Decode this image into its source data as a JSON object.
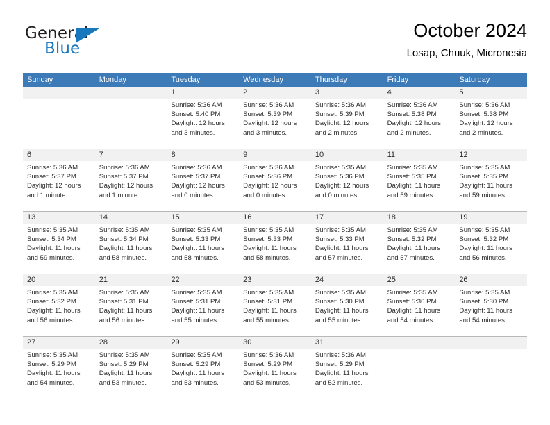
{
  "logo": {
    "word_one": "General",
    "word_two": "Blue",
    "triangle_color": "#1878be",
    "text_color": "#231f20"
  },
  "header": {
    "title": "October 2024",
    "subtitle": "Losap, Chuuk, Micronesia"
  },
  "colors": {
    "header_band": "#3d7ab8",
    "day_band": "#f1f1f1",
    "grid_line": "#b8b8b8",
    "text": "#2b2b2b"
  },
  "weekday_headers": [
    "Sunday",
    "Monday",
    "Tuesday",
    "Wednesday",
    "Thursday",
    "Friday",
    "Saturday"
  ],
  "weeks": [
    [
      {
        "day": "",
        "empty": true,
        "sunrise": "",
        "sunset": "",
        "daylight_line1": "",
        "daylight_line2": ""
      },
      {
        "day": "",
        "empty": true,
        "sunrise": "",
        "sunset": "",
        "daylight_line1": "",
        "daylight_line2": ""
      },
      {
        "day": "1",
        "sunrise": "Sunrise: 5:36 AM",
        "sunset": "Sunset: 5:40 PM",
        "daylight_line1": "Daylight: 12 hours",
        "daylight_line2": "and 3 minutes."
      },
      {
        "day": "2",
        "sunrise": "Sunrise: 5:36 AM",
        "sunset": "Sunset: 5:39 PM",
        "daylight_line1": "Daylight: 12 hours",
        "daylight_line2": "and 3 minutes."
      },
      {
        "day": "3",
        "sunrise": "Sunrise: 5:36 AM",
        "sunset": "Sunset: 5:39 PM",
        "daylight_line1": "Daylight: 12 hours",
        "daylight_line2": "and 2 minutes."
      },
      {
        "day": "4",
        "sunrise": "Sunrise: 5:36 AM",
        "sunset": "Sunset: 5:38 PM",
        "daylight_line1": "Daylight: 12 hours",
        "daylight_line2": "and 2 minutes."
      },
      {
        "day": "5",
        "sunrise": "Sunrise: 5:36 AM",
        "sunset": "Sunset: 5:38 PM",
        "daylight_line1": "Daylight: 12 hours",
        "daylight_line2": "and 2 minutes."
      }
    ],
    [
      {
        "day": "6",
        "sunrise": "Sunrise: 5:36 AM",
        "sunset": "Sunset: 5:37 PM",
        "daylight_line1": "Daylight: 12 hours",
        "daylight_line2": "and 1 minute."
      },
      {
        "day": "7",
        "sunrise": "Sunrise: 5:36 AM",
        "sunset": "Sunset: 5:37 PM",
        "daylight_line1": "Daylight: 12 hours",
        "daylight_line2": "and 1 minute."
      },
      {
        "day": "8",
        "sunrise": "Sunrise: 5:36 AM",
        "sunset": "Sunset: 5:37 PM",
        "daylight_line1": "Daylight: 12 hours",
        "daylight_line2": "and 0 minutes."
      },
      {
        "day": "9",
        "sunrise": "Sunrise: 5:36 AM",
        "sunset": "Sunset: 5:36 PM",
        "daylight_line1": "Daylight: 12 hours",
        "daylight_line2": "and 0 minutes."
      },
      {
        "day": "10",
        "sunrise": "Sunrise: 5:35 AM",
        "sunset": "Sunset: 5:36 PM",
        "daylight_line1": "Daylight: 12 hours",
        "daylight_line2": "and 0 minutes."
      },
      {
        "day": "11",
        "sunrise": "Sunrise: 5:35 AM",
        "sunset": "Sunset: 5:35 PM",
        "daylight_line1": "Daylight: 11 hours",
        "daylight_line2": "and 59 minutes."
      },
      {
        "day": "12",
        "sunrise": "Sunrise: 5:35 AM",
        "sunset": "Sunset: 5:35 PM",
        "daylight_line1": "Daylight: 11 hours",
        "daylight_line2": "and 59 minutes."
      }
    ],
    [
      {
        "day": "13",
        "sunrise": "Sunrise: 5:35 AM",
        "sunset": "Sunset: 5:34 PM",
        "daylight_line1": "Daylight: 11 hours",
        "daylight_line2": "and 59 minutes."
      },
      {
        "day": "14",
        "sunrise": "Sunrise: 5:35 AM",
        "sunset": "Sunset: 5:34 PM",
        "daylight_line1": "Daylight: 11 hours",
        "daylight_line2": "and 58 minutes."
      },
      {
        "day": "15",
        "sunrise": "Sunrise: 5:35 AM",
        "sunset": "Sunset: 5:33 PM",
        "daylight_line1": "Daylight: 11 hours",
        "daylight_line2": "and 58 minutes."
      },
      {
        "day": "16",
        "sunrise": "Sunrise: 5:35 AM",
        "sunset": "Sunset: 5:33 PM",
        "daylight_line1": "Daylight: 11 hours",
        "daylight_line2": "and 58 minutes."
      },
      {
        "day": "17",
        "sunrise": "Sunrise: 5:35 AM",
        "sunset": "Sunset: 5:33 PM",
        "daylight_line1": "Daylight: 11 hours",
        "daylight_line2": "and 57 minutes."
      },
      {
        "day": "18",
        "sunrise": "Sunrise: 5:35 AM",
        "sunset": "Sunset: 5:32 PM",
        "daylight_line1": "Daylight: 11 hours",
        "daylight_line2": "and 57 minutes."
      },
      {
        "day": "19",
        "sunrise": "Sunrise: 5:35 AM",
        "sunset": "Sunset: 5:32 PM",
        "daylight_line1": "Daylight: 11 hours",
        "daylight_line2": "and 56 minutes."
      }
    ],
    [
      {
        "day": "20",
        "sunrise": "Sunrise: 5:35 AM",
        "sunset": "Sunset: 5:32 PM",
        "daylight_line1": "Daylight: 11 hours",
        "daylight_line2": "and 56 minutes."
      },
      {
        "day": "21",
        "sunrise": "Sunrise: 5:35 AM",
        "sunset": "Sunset: 5:31 PM",
        "daylight_line1": "Daylight: 11 hours",
        "daylight_line2": "and 56 minutes."
      },
      {
        "day": "22",
        "sunrise": "Sunrise: 5:35 AM",
        "sunset": "Sunset: 5:31 PM",
        "daylight_line1": "Daylight: 11 hours",
        "daylight_line2": "and 55 minutes."
      },
      {
        "day": "23",
        "sunrise": "Sunrise: 5:35 AM",
        "sunset": "Sunset: 5:31 PM",
        "daylight_line1": "Daylight: 11 hours",
        "daylight_line2": "and 55 minutes."
      },
      {
        "day": "24",
        "sunrise": "Sunrise: 5:35 AM",
        "sunset": "Sunset: 5:30 PM",
        "daylight_line1": "Daylight: 11 hours",
        "daylight_line2": "and 55 minutes."
      },
      {
        "day": "25",
        "sunrise": "Sunrise: 5:35 AM",
        "sunset": "Sunset: 5:30 PM",
        "daylight_line1": "Daylight: 11 hours",
        "daylight_line2": "and 54 minutes."
      },
      {
        "day": "26",
        "sunrise": "Sunrise: 5:35 AM",
        "sunset": "Sunset: 5:30 PM",
        "daylight_line1": "Daylight: 11 hours",
        "daylight_line2": "and 54 minutes."
      }
    ],
    [
      {
        "day": "27",
        "sunrise": "Sunrise: 5:35 AM",
        "sunset": "Sunset: 5:29 PM",
        "daylight_line1": "Daylight: 11 hours",
        "daylight_line2": "and 54 minutes."
      },
      {
        "day": "28",
        "sunrise": "Sunrise: 5:35 AM",
        "sunset": "Sunset: 5:29 PM",
        "daylight_line1": "Daylight: 11 hours",
        "daylight_line2": "and 53 minutes."
      },
      {
        "day": "29",
        "sunrise": "Sunrise: 5:35 AM",
        "sunset": "Sunset: 5:29 PM",
        "daylight_line1": "Daylight: 11 hours",
        "daylight_line2": "and 53 minutes."
      },
      {
        "day": "30",
        "sunrise": "Sunrise: 5:36 AM",
        "sunset": "Sunset: 5:29 PM",
        "daylight_line1": "Daylight: 11 hours",
        "daylight_line2": "and 53 minutes."
      },
      {
        "day": "31",
        "sunrise": "Sunrise: 5:36 AM",
        "sunset": "Sunset: 5:29 PM",
        "daylight_line1": "Daylight: 11 hours",
        "daylight_line2": "and 52 minutes."
      },
      {
        "day": "",
        "empty": true,
        "sunrise": "",
        "sunset": "",
        "daylight_line1": "",
        "daylight_line2": ""
      },
      {
        "day": "",
        "empty": true,
        "sunrise": "",
        "sunset": "",
        "daylight_line1": "",
        "daylight_line2": ""
      }
    ]
  ]
}
